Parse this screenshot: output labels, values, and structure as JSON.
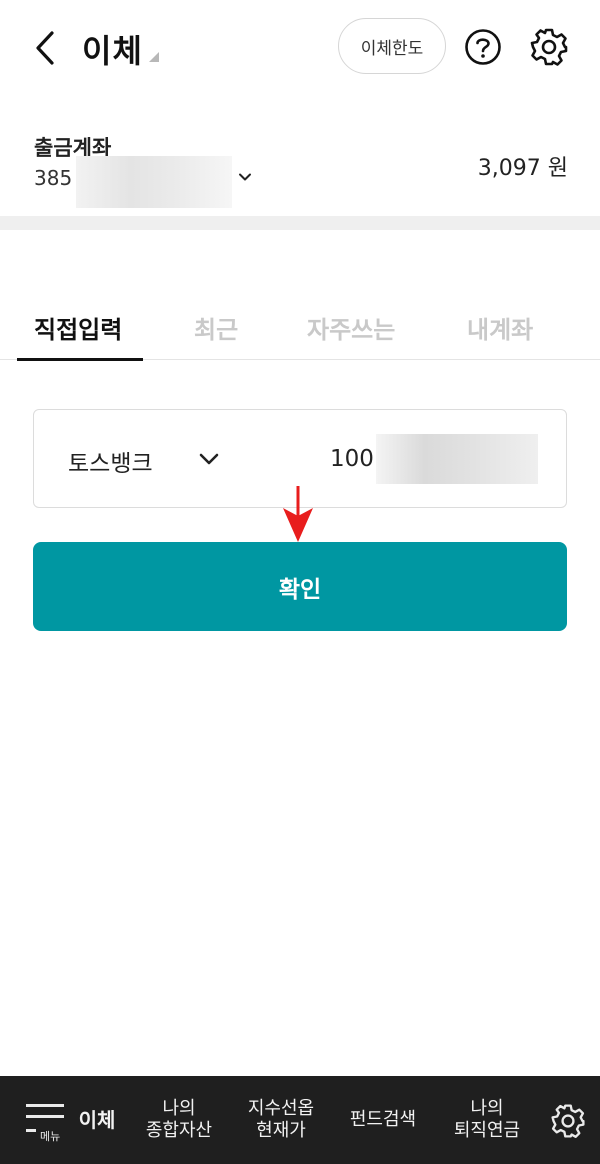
{
  "header": {
    "back_icon": "chevron-left-icon",
    "title": "이체",
    "limit_button": "이체한도",
    "help_icon": "question-circle-icon",
    "settings_icon": "gear-icon"
  },
  "account": {
    "label": "출금계좌",
    "number_prefix": "385",
    "balance": "3,097 원"
  },
  "tabs": [
    {
      "label": "직접입력",
      "active": true
    },
    {
      "label": "최근",
      "active": false
    },
    {
      "label": "자주쓰는",
      "active": false
    },
    {
      "label": "내계좌",
      "active": false
    }
  ],
  "transfer_input": {
    "bank": "토스뱅크",
    "account_prefix": "100"
  },
  "confirm_label": "확인",
  "accent_color": "#0097a2",
  "bottom_nav": {
    "menu_label": "메뉴",
    "items": [
      {
        "label": "이체"
      },
      {
        "label": "나의\n종합자산"
      },
      {
        "label": "지수선옵\n현재가"
      },
      {
        "label": "펀드검색"
      },
      {
        "label": "나의\n퇴직연금"
      }
    ],
    "settings_icon": "gear-icon"
  }
}
